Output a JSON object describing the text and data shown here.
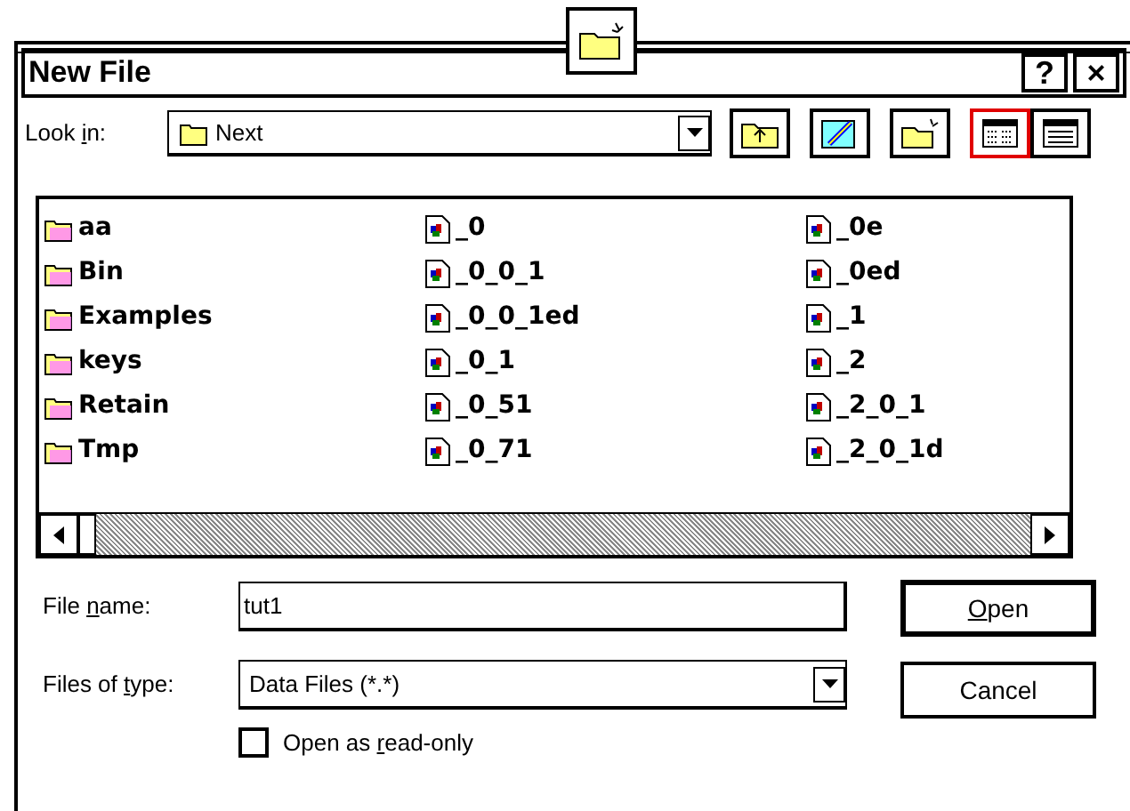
{
  "window": {
    "title": "New File",
    "buttons": [
      "?",
      "×"
    ]
  },
  "look_in": {
    "label": {
      "pre": "Look ",
      "key": "i",
      "post": "n:"
    },
    "value": "Next"
  },
  "view_buttons": [
    {
      "kind": "list",
      "selected": true
    },
    {
      "kind": "details",
      "selected": false
    }
  ],
  "file_columns": [
    [
      {
        "kind": "folder",
        "name": "aa"
      },
      {
        "kind": "folder",
        "name": "Bin"
      },
      {
        "kind": "folder",
        "name": "Examples"
      },
      {
        "kind": "folder",
        "name": "keys"
      },
      {
        "kind": "folder",
        "name": "Retain"
      },
      {
        "kind": "folder",
        "name": "Tmp"
      }
    ],
    [
      {
        "kind": "file",
        "name": "_0"
      },
      {
        "kind": "file",
        "name": "_0_0_1"
      },
      {
        "kind": "file",
        "name": "_0_0_1ed"
      },
      {
        "kind": "file",
        "name": "_0_1"
      },
      {
        "kind": "file",
        "name": "_0_51"
      },
      {
        "kind": "file",
        "name": "_0_71"
      }
    ],
    [
      {
        "kind": "file",
        "name": "_0e"
      },
      {
        "kind": "file",
        "name": "_0ed"
      },
      {
        "kind": "file",
        "name": "_1"
      },
      {
        "kind": "file",
        "name": "_2"
      },
      {
        "kind": "file",
        "name": "_2_0_1"
      },
      {
        "kind": "file",
        "name": "_2_0_1d"
      }
    ]
  ],
  "file_name": {
    "label": {
      "pre": "File ",
      "key": "n",
      "post": "ame:"
    },
    "value": "tut1"
  },
  "file_type": {
    "label": {
      "pre": "Files of ",
      "key": "t",
      "post": "ype:"
    },
    "value": "Data Files (*.*)"
  },
  "buttons": [
    {
      "label": {
        "key": "O",
        "post": "pen"
      },
      "default": true
    },
    {
      "label": {
        "pre": "Cancel"
      },
      "default": false
    }
  ],
  "read_only": {
    "label": {
      "pre": "Open as ",
      "key": "r",
      "post": "ead-only"
    },
    "checked": false
  }
}
